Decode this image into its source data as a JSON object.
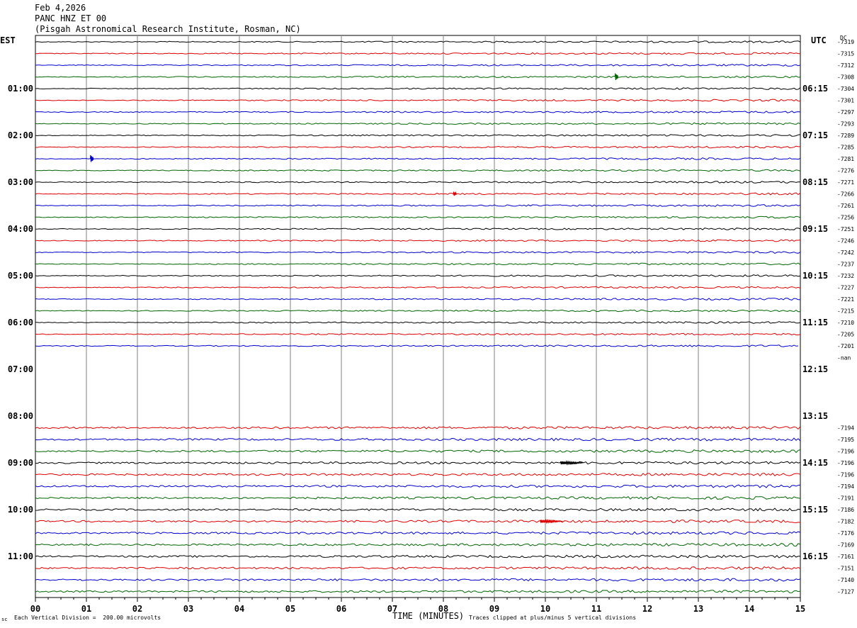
{
  "header": {
    "date": "Feb 4,2026",
    "station": "PANC HNZ ET 00",
    "location": "(Pisgah Astronomical Research Institute, Rosman, NC)"
  },
  "left_zone": "EST",
  "right_zone": "UTC",
  "dc_header": "DC",
  "footer": {
    "scale": "Each Vertical Division =  200.00 microvolts",
    "clip": "Traces clipped at plus/minus 5 vertical divisions",
    "logo": "sc"
  },
  "colors": {
    "trace_cycle": [
      "#000000",
      "#dd0000",
      "#0000cc",
      "#006600"
    ],
    "grid": "#808080"
  },
  "chart_data": {
    "type": "line",
    "title": "PANC HNZ ET 00",
    "xlabel": "TIME (MINUTES)",
    "ylabel": "",
    "xlim": [
      0,
      15
    ],
    "x_ticks": [
      "00",
      "01",
      "02",
      "03",
      "04",
      "05",
      "06",
      "07",
      "08",
      "09",
      "10",
      "11",
      "12",
      "13",
      "14",
      "15"
    ],
    "left_hour_labels": [
      "01:00",
      "02:00",
      "03:00",
      "04:00",
      "05:00",
      "06:00",
      "07:00",
      "08:00",
      "09:00",
      "10:00",
      "11:00"
    ],
    "right_hour_labels": [
      "06:15",
      "07:15",
      "08:15",
      "09:15",
      "10:15",
      "11:15",
      "12:15",
      "13:15",
      "14:15",
      "15:15",
      "16:15"
    ],
    "rows_per_hour": 4,
    "dc_offsets": [
      "-7319",
      "-7315",
      "-7312",
      "-7308",
      "-7304",
      "-7301",
      "-7297",
      "-7293",
      "-7289",
      "-7285",
      "-7281",
      "-7276",
      "-7271",
      "-7266",
      "-7261",
      "-7256",
      "-7251",
      "-7246",
      "-7242",
      "-7237",
      "-7232",
      "-7227",
      "-7221",
      "-7215",
      "-7210",
      "-7205",
      "-7201",
      "-nan",
      "",
      "",
      "",
      "",
      "",
      "-7194",
      "-7195",
      "-7196",
      "-7196",
      "-7196",
      "-7194",
      "-7191",
      "-7186",
      "-7182",
      "-7176",
      "-7169",
      "-7161",
      "-7151",
      "-7140",
      "-7127"
    ],
    "events": [
      {
        "row": 3,
        "minute": 11.37,
        "amplitude": "small"
      },
      {
        "row": 10,
        "minute": 1.08,
        "amplitude": "small"
      },
      {
        "row": 13,
        "minute": 8.2,
        "amplitude": "tiny"
      },
      {
        "row": 36,
        "minute": 10.3,
        "amplitude": "noise burst"
      },
      {
        "row": 41,
        "minute": 9.9,
        "amplitude": "noise burst"
      }
    ]
  }
}
